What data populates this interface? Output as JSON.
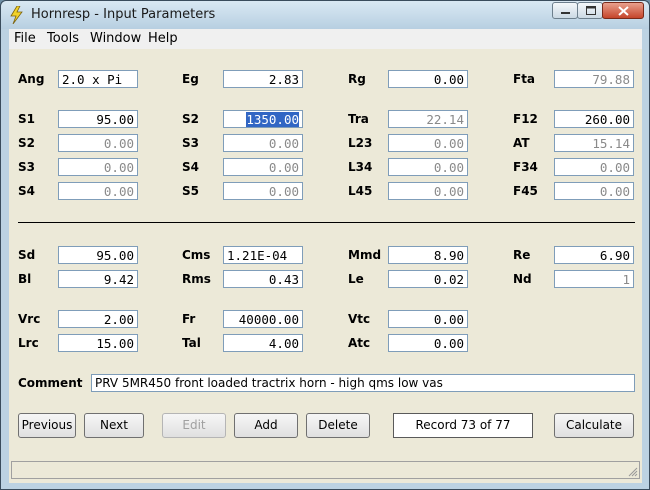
{
  "window": {
    "title": "Hornresp - Input Parameters"
  },
  "menu": [
    "File",
    "Tools",
    "Window",
    "Help"
  ],
  "icons": {
    "app": "lightning-icon",
    "minimize": "minimize-icon",
    "maximize": "maximize-icon",
    "close": "close-icon"
  },
  "params": {
    "ang": "2.0 x Pi",
    "eg": "2.83",
    "rg": "0.00",
    "fta": "79.88",
    "s1": "95.00",
    "s2": "1350.00",
    "tra": "22.14",
    "f12": "260.00",
    "s2b": "0.00",
    "s3": "0.00",
    "l23": "0.00",
    "at": "15.14",
    "s3b": "0.00",
    "s4": "0.00",
    "l34": "0.00",
    "f34": "0.00",
    "s4b": "0.00",
    "s5": "0.00",
    "l45": "0.00",
    "f45": "0.00",
    "sd": "95.00",
    "cms": "1.21E-04",
    "mmd": "8.90",
    "re": "6.90",
    "bl": "9.42",
    "rms": "0.43",
    "le": "0.02",
    "nd": "1",
    "vrc": "2.00",
    "fr": "40000.00",
    "vtc": "0.00",
    "lrc": "15.00",
    "tal": "4.00",
    "atc": "0.00"
  },
  "labels": {
    "ang": "Ang",
    "eg": "Eg",
    "rg": "Rg",
    "fta": "Fta",
    "s1": "S1",
    "s2": "S2",
    "tra": "Tra",
    "f12": "F12",
    "s2b": "S2",
    "s3": "S3",
    "l23": "L23",
    "at": "AT",
    "s3b": "S3",
    "s4": "S4",
    "l34": "L34",
    "f34": "F34",
    "s4b": "S4",
    "s5": "S5",
    "l45": "L45",
    "f45": "F45",
    "sd": "Sd",
    "cms": "Cms",
    "mmd": "Mmd",
    "re": "Re",
    "bl": "Bl",
    "rms": "Rms",
    "le": "Le",
    "nd": "Nd",
    "vrc": "Vrc",
    "fr": "Fr",
    "vtc": "Vtc",
    "lrc": "Lrc",
    "tal": "Tal",
    "atc": "Atc",
    "comment": "Comment"
  },
  "comment": "PRV 5MR450 front loaded tractrix horn - high qms low vas",
  "buttons": {
    "previous": "Previous",
    "next": "Next",
    "edit": "Edit",
    "add": "Add",
    "delete": "Delete",
    "calculate": "Calculate"
  },
  "record": "Record 73 of 77"
}
